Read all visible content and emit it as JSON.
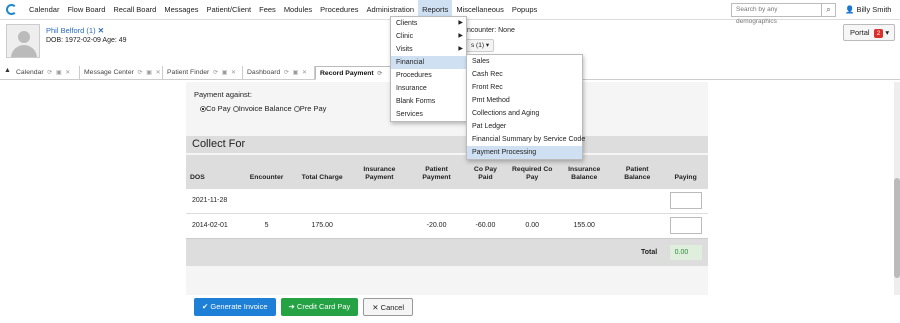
{
  "nav": {
    "items": [
      "Calendar",
      "Flow Board",
      "Recall Board",
      "Messages",
      "Patient/Client",
      "Fees",
      "Modules",
      "Procedures",
      "Administration",
      "Reports",
      "Miscellaneous",
      "Popups"
    ],
    "active": "Reports",
    "search_placeholder": "Search by any demographics",
    "user": "Billy Smith"
  },
  "patient": {
    "name": "Phil Belford (1)",
    "dob_age": "DOB: 1972-02-09 Age: 49",
    "encounter": "ncounter: None",
    "visits_dd": "s (1)"
  },
  "portal": {
    "label": "Portal",
    "count": "2"
  },
  "tabs": [
    {
      "label": "Calendar"
    },
    {
      "label": "Message Center"
    },
    {
      "label": "Patient Finder"
    },
    {
      "label": "Dashboard"
    },
    {
      "label": "Record Payment"
    }
  ],
  "reports_menu": [
    "Clients",
    "Clinic",
    "Visits",
    "Financial",
    "Procedures",
    "Insurance",
    "Blank Forms",
    "Services"
  ],
  "financial_menu": [
    "Sales",
    "Cash Rec",
    "Front Rec",
    "Pmt Method",
    "Collections and Aging",
    "Pat Ledger",
    "Financial Summary by Service Code",
    "Payment Processing"
  ],
  "payment": {
    "label": "Payment against:",
    "options": [
      "Co Pay",
      "Invoice Balance",
      "Pre Pay"
    ],
    "section_title": "Collect For",
    "headers": [
      "DOS",
      "Encounter",
      "Total Charge",
      "Insurance Payment",
      "Patient Payment",
      "Co Pay Paid",
      "Required Co Pay",
      "Insurance Balance",
      "Patient Balance",
      "Paying"
    ],
    "rows": [
      [
        "2021-11-28",
        "",
        "",
        "",
        "",
        "",
        "",
        "",
        ""
      ],
      [
        "2014-02-01",
        "5",
        "175.00",
        "",
        "-20.00",
        "-60.00",
        "0.00",
        "155.00",
        ""
      ]
    ],
    "total_label": "Total",
    "total_value": "0.00"
  },
  "buttons": {
    "generate": "Generate Invoice",
    "credit": "Credit Card Pay",
    "cancel": "Cancel"
  }
}
